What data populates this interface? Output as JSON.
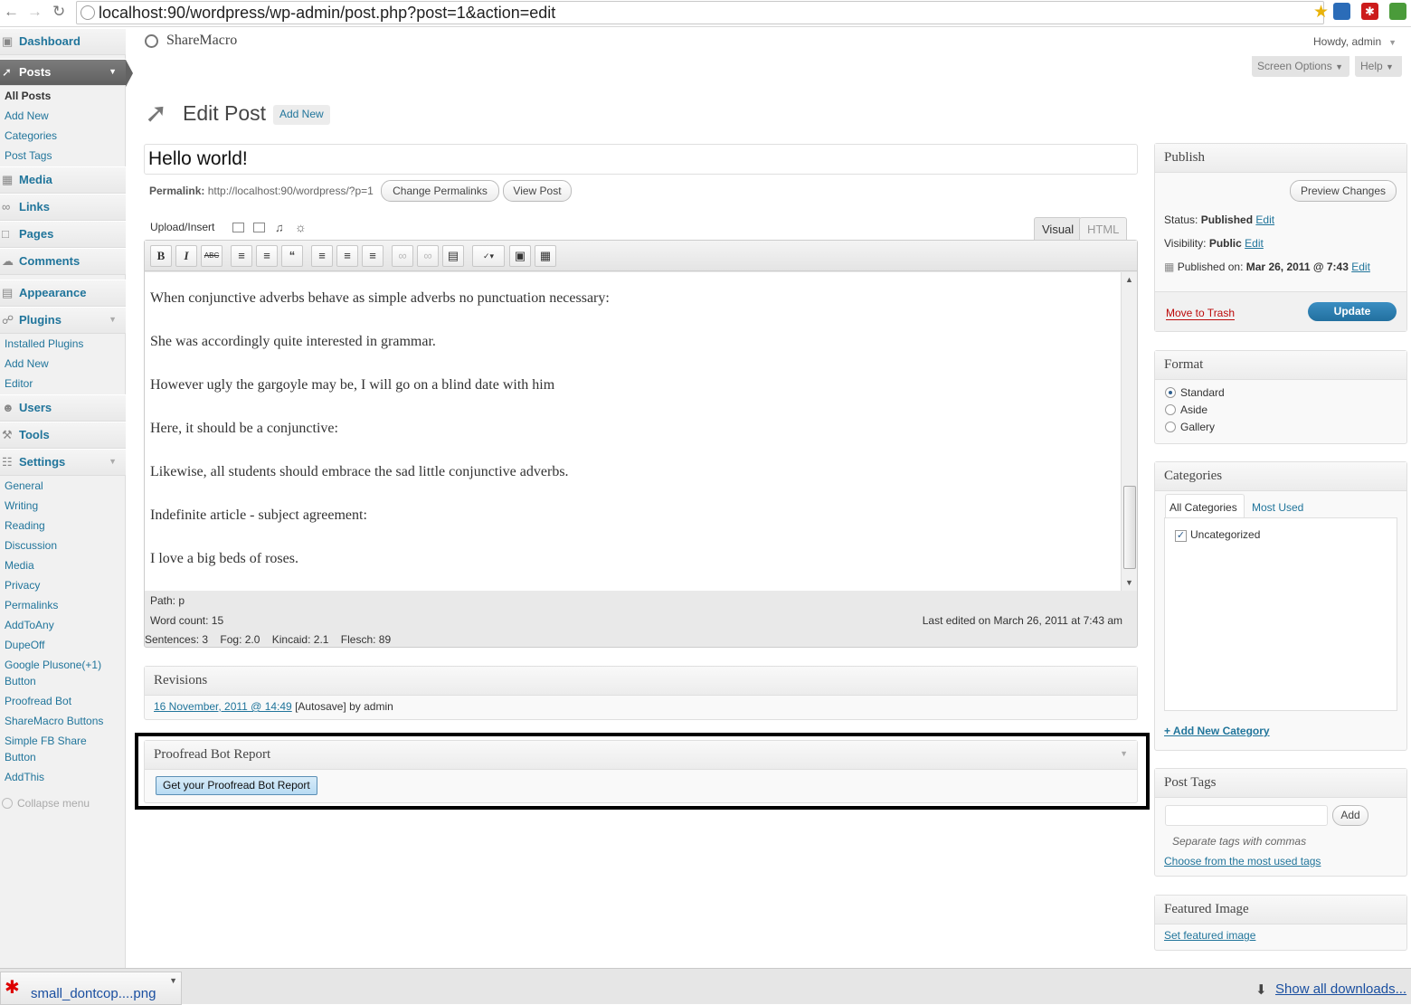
{
  "browser": {
    "url": "localhost:90/wordpress/wp-admin/post.php?post=1&action=edit"
  },
  "sidebar": {
    "top": [
      {
        "label": "Dashboard"
      },
      {
        "label": "Posts"
      },
      {
        "label": "Media"
      },
      {
        "label": "Links"
      },
      {
        "label": "Pages"
      },
      {
        "label": "Comments"
      },
      {
        "label": "Appearance"
      },
      {
        "label": "Plugins"
      },
      {
        "label": "Users"
      },
      {
        "label": "Tools"
      },
      {
        "label": "Settings"
      }
    ],
    "posts_sub": [
      "All Posts",
      "Add New",
      "Categories",
      "Post Tags"
    ],
    "plugins_sub": [
      "Installed Plugins",
      "Add New",
      "Editor"
    ],
    "settings_sub": [
      "General",
      "Writing",
      "Reading",
      "Discussion",
      "Media",
      "Privacy",
      "Permalinks",
      "AddToAny",
      "DupeOff",
      "Google Plusone(+1)",
      "Button",
      "Proofread Bot",
      "ShareMacro Buttons",
      "Simple FB Share",
      "Button",
      "AddThis"
    ],
    "collapse": "Collapse menu"
  },
  "header": {
    "site_name": "ShareMacro",
    "howdy": "Howdy, admin",
    "screen_options": "Screen Options",
    "help": "Help"
  },
  "page": {
    "title": "Edit Post",
    "add_new": "Add New"
  },
  "post": {
    "title": "Hello world!",
    "permalink_label": "Permalink:",
    "permalink_url": "http://localhost:90/wordpress/?p=1",
    "change_permalinks": "Change Permalinks",
    "view_post": "View Post"
  },
  "editor": {
    "upload_insert": "Upload/Insert",
    "tab_visual": "Visual",
    "tab_html": "HTML",
    "paragraphs": [
      "When conjunctive adverbs behave as simple adverbs no punctuation necessary:",
      "She was accordingly quite interested in grammar.",
      "However ugly the gargoyle may be, I will go on a blind date with him",
      "Here, it should be a conjunctive:",
      " Likewise, all students should embrace the sad little conjunctive adverbs.",
      "Indefinite article - subject agreement:",
      "I love a big beds of roses."
    ],
    "path": "Path: p",
    "word_count": "Word count: 15",
    "last_edited": "Last edited on March 26, 2011 at 7:43 am",
    "stats": "Sentences: 3    Fog: 2.0    Kincaid: 2.1    Flesch: 89"
  },
  "revisions": {
    "title": "Revisions",
    "link": "16 November, 2011 @ 14:49",
    "rest": " [Autosave] by admin"
  },
  "proofread": {
    "title": "Proofread Bot Report",
    "button": "Get your Proofread Bot Report"
  },
  "publish": {
    "title": "Publish",
    "preview": "Preview Changes",
    "status_label": "Status:",
    "status_value": "Published",
    "visibility_label": "Visibility:",
    "visibility_value": "Public",
    "published_on_label": "Published on:",
    "published_on_value": "Mar 26, 2011 @ 7:43",
    "edit": "Edit",
    "trash": "Move to Trash",
    "update": "Update"
  },
  "format": {
    "title": "Format",
    "options": [
      "Standard",
      "Aside",
      "Gallery"
    ],
    "selected": "Standard"
  },
  "categories": {
    "title": "Categories",
    "tab_all": "All Categories",
    "tab_used": "Most Used",
    "items": [
      {
        "label": "Uncategorized",
        "checked": true
      }
    ],
    "add_new": "+ Add New Category"
  },
  "tags": {
    "title": "Post Tags",
    "add": "Add",
    "hint": "Separate tags with commas",
    "choose": "Choose from the most used tags"
  },
  "featured": {
    "title": "Featured Image",
    "link": "Set featured image"
  },
  "downloads": {
    "file": "small_dontcop....png",
    "show_all": "Show all downloads..."
  },
  "colors": {
    "link": "#21759b",
    "current_menu": "#6d6d6d",
    "update_button": "#2a7bb0",
    "trash": "#bc0b0b",
    "highlight_border": "#000000"
  }
}
